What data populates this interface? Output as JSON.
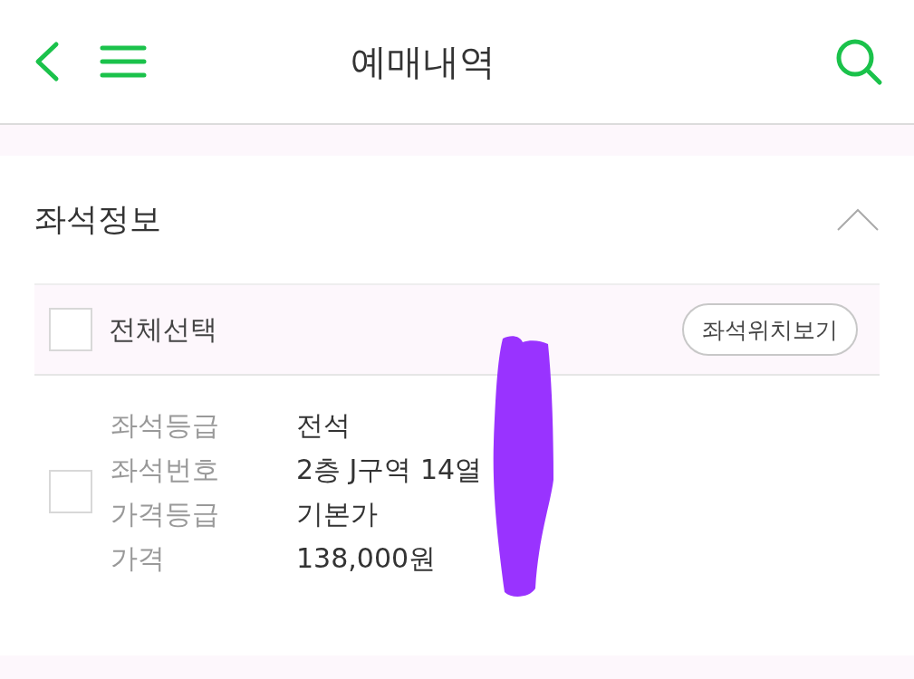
{
  "header": {
    "title": "예매내역"
  },
  "section": {
    "title": "좌석정보",
    "expanded": true,
    "select_all": {
      "label": "전체선택",
      "checked": false
    },
    "seat_map_button": "좌석위치보기",
    "items": [
      {
        "checked": false,
        "fields": [
          {
            "label": "좌석등급",
            "value": "전석"
          },
          {
            "label": "좌석번호",
            "value": "2층 J구역 14열"
          },
          {
            "label": "가격등급",
            "value": "기본가"
          },
          {
            "label": "가격",
            "value": "138,000원"
          }
        ]
      }
    ]
  }
}
